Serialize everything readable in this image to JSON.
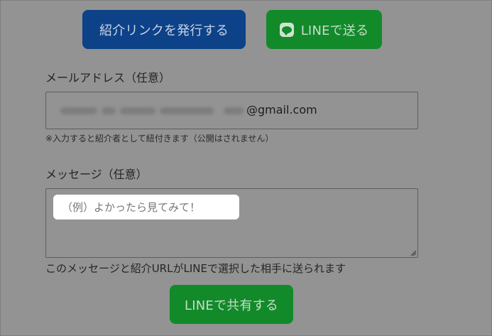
{
  "actions": {
    "issue_link_label": "紹介リンクを発行する",
    "send_line_label": "LINEで送る"
  },
  "email": {
    "label": "メールアドレス（任意）",
    "value_suffix": "@gmail.com",
    "note": "※入力すると紹介者として紐付きます（公開はされません）"
  },
  "message": {
    "label": "メッセージ（任意）",
    "placeholder": "（例）よかったら見てみて！",
    "help": "このメッセージと紹介URLがLINEで選択した相手に送られます"
  },
  "share": {
    "label": "LINEで共有する"
  },
  "icons": {
    "line": "line-chat-icon",
    "resize": "resize-handle-icon"
  },
  "colors": {
    "background": "#939393",
    "primary_blue": "#0d4289",
    "line_green": "#128a2a"
  }
}
